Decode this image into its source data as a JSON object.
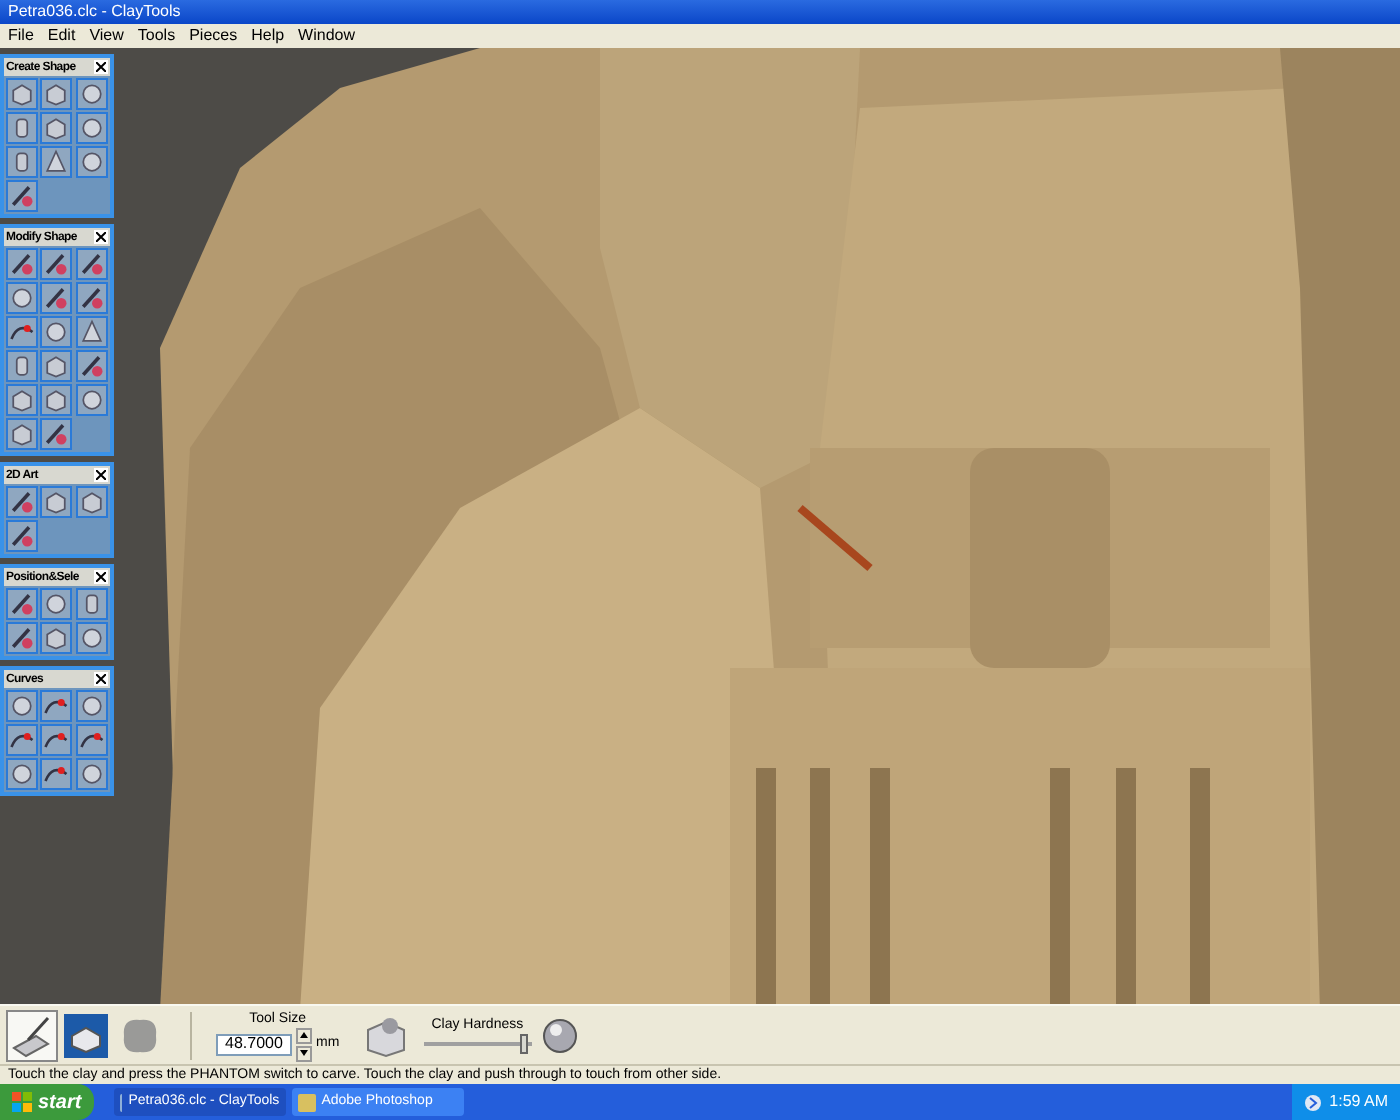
{
  "window": {
    "title": "Petra036.clc - ClayTools"
  },
  "menu": [
    "File",
    "Edit",
    "View",
    "Tools",
    "Pieces",
    "Help",
    "Window"
  ],
  "panels": [
    {
      "title": "Create Shape",
      "tools": [
        {
          "kind": "cube"
        },
        {
          "kind": "cube"
        },
        {
          "kind": "sphere"
        },
        {
          "kind": "cylinder"
        },
        {
          "kind": "cube"
        },
        {
          "kind": "sphere"
        },
        {
          "kind": "cylinder"
        },
        {
          "kind": "cone"
        },
        {
          "kind": "sphere"
        },
        {
          "kind": "brush"
        }
      ]
    },
    {
      "title": "Modify Shape",
      "tools": [
        {
          "kind": "brush"
        },
        {
          "kind": "brush"
        },
        {
          "kind": "brush"
        },
        {
          "kind": "sphere"
        },
        {
          "kind": "brush"
        },
        {
          "kind": "brush"
        },
        {
          "kind": "curve"
        },
        {
          "kind": "sphere"
        },
        {
          "kind": "cone"
        },
        {
          "kind": "cylinder"
        },
        {
          "kind": "cube"
        },
        {
          "kind": "brush"
        },
        {
          "kind": "cube"
        },
        {
          "kind": "cube"
        },
        {
          "kind": "sphere"
        },
        {
          "kind": "cube"
        },
        {
          "kind": "brush"
        }
      ]
    },
    {
      "title": "2D Art",
      "tools": [
        {
          "kind": "brush"
        },
        {
          "kind": "cube"
        },
        {
          "kind": "cube"
        },
        {
          "kind": "brush"
        }
      ]
    },
    {
      "title": "Position&Sele",
      "tools": [
        {
          "kind": "brush"
        },
        {
          "kind": "sphere"
        },
        {
          "kind": "cylinder"
        },
        {
          "kind": "brush"
        },
        {
          "kind": "cube"
        },
        {
          "kind": "sphere"
        }
      ]
    },
    {
      "title": "Curves",
      "tools": [
        {
          "kind": "sphere"
        },
        {
          "kind": "curve"
        },
        {
          "kind": "sphere"
        },
        {
          "kind": "curve"
        },
        {
          "kind": "curve"
        },
        {
          "kind": "curve"
        },
        {
          "kind": "sphere"
        },
        {
          "kind": "curve"
        },
        {
          "kind": "sphere"
        }
      ]
    }
  ],
  "toolbar": {
    "modes": [
      {
        "kind": "carve",
        "selected": true
      },
      {
        "kind": "cube",
        "selected": false
      },
      {
        "kind": "blob",
        "selected": false
      }
    ],
    "tool_size": {
      "label": "Tool Size",
      "value": "48.7000",
      "unit": "mm"
    },
    "clay_hardness": {
      "label": "Clay Hardness",
      "level": 0.97
    }
  },
  "status_bar": "Touch the clay and press the PHANTOM switch to carve. Touch the clay and push through to touch from other side.",
  "taskbar": {
    "start": "start",
    "tasks": [
      {
        "label": "Petra036.clc - ClayTools",
        "selected": true
      },
      {
        "label": "Adobe Photoshop",
        "selected": false
      }
    ],
    "clock": "1:59 AM"
  }
}
